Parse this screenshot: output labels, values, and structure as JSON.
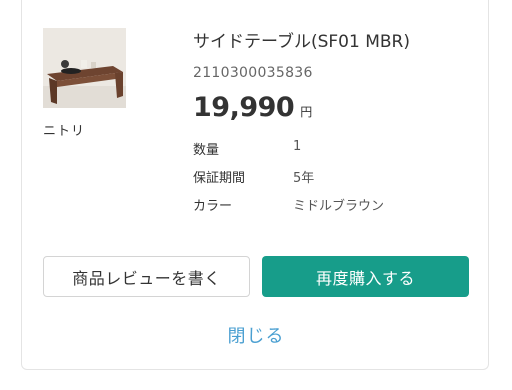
{
  "product": {
    "image_icon": "side-table-image",
    "maker": "ニトリ",
    "name": "サイドテーブル(SF01 MBR)",
    "code": "2110300035836",
    "price": "19,990",
    "price_unit": "円"
  },
  "specs": [
    {
      "label": "数量",
      "value": "1"
    },
    {
      "label": "保証期間",
      "value": "5年"
    },
    {
      "label": "カラー",
      "value": "ミドルブラウン"
    }
  ],
  "actions": {
    "review_label": "商品レビューを書く",
    "reorder_label": "再度購入する",
    "close_label": "閉じる"
  },
  "colors": {
    "accent": "#179d8a",
    "link": "#4a9fd1"
  }
}
